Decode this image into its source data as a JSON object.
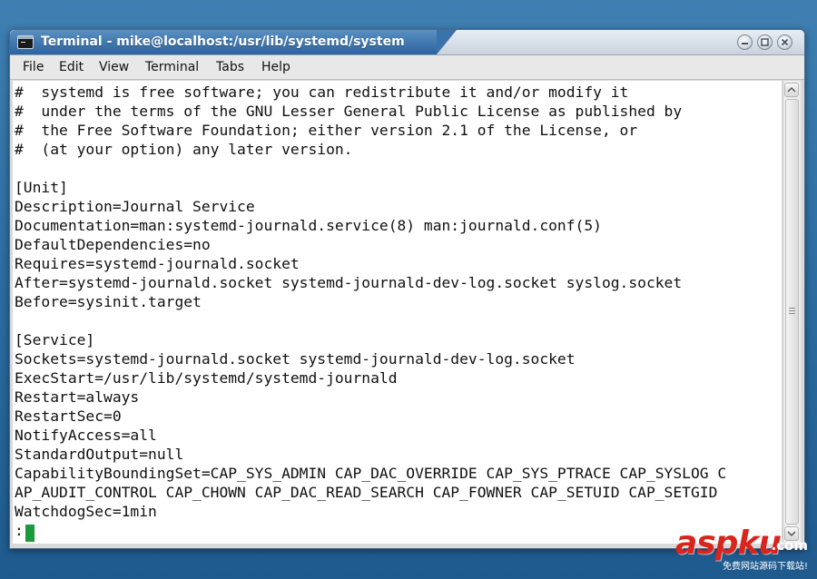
{
  "window": {
    "title": "Terminal - mike@localhost:/usr/lib/systemd/system"
  },
  "menu": [
    "File",
    "Edit",
    "View",
    "Terminal",
    "Tabs",
    "Help"
  ],
  "terminal": {
    "lines": [
      "#  systemd is free software; you can redistribute it and/or modify it",
      "#  under the terms of the GNU Lesser General Public License as published by",
      "#  the Free Software Foundation; either version 2.1 of the License, or",
      "#  (at your option) any later version.",
      "",
      "[Unit]",
      "Description=Journal Service",
      "Documentation=man:systemd-journald.service(8) man:journald.conf(5)",
      "DefaultDependencies=no",
      "Requires=systemd-journald.socket",
      "After=systemd-journald.socket systemd-journald-dev-log.socket syslog.socket",
      "Before=sysinit.target",
      "",
      "[Service]",
      "Sockets=systemd-journald.socket systemd-journald-dev-log.socket",
      "ExecStart=/usr/lib/systemd/systemd-journald",
      "Restart=always",
      "RestartSec=0",
      "NotifyAccess=all",
      "StandardOutput=null",
      "CapabilityBoundingSet=CAP_SYS_ADMIN CAP_DAC_OVERRIDE CAP_SYS_PTRACE CAP_SYSLOG C",
      "AP_AUDIT_CONTROL CAP_CHOWN CAP_DAC_READ_SEARCH CAP_FOWNER CAP_SETUID CAP_SETGID",
      "WatchdogSec=1min",
      ":"
    ]
  },
  "watermark": {
    "logo": "aspku",
    "domain": ".com",
    "tagline": "免费网站源码下载站!"
  },
  "colors": {
    "desktop": "#2d6ea3",
    "titlebar_active": "#2c64a0",
    "terminal_bg": "#ffffff",
    "cursor": "#1a9a3a",
    "watermark_red": "#d8261e"
  },
  "icons": {
    "app": "terminal-icon",
    "minimize": "minimize-icon",
    "maximize": "maximize-icon",
    "close": "close-icon",
    "scroll_up": "arrow-up-icon",
    "scroll_down": "arrow-down-icon"
  }
}
